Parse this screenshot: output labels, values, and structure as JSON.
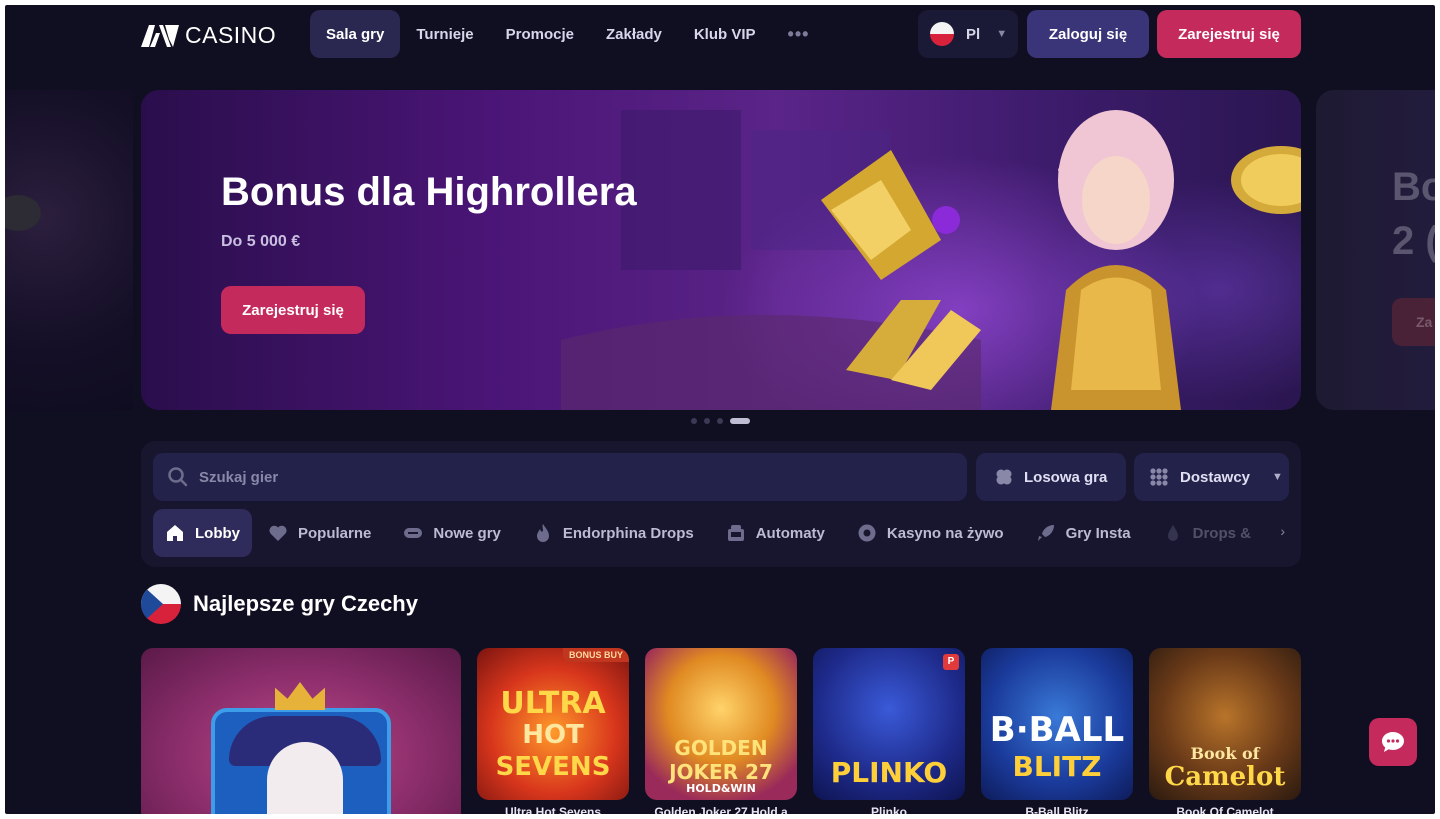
{
  "header": {
    "logo_text": "CASINO",
    "nav": [
      {
        "label": "Sala gry",
        "active": true
      },
      {
        "label": "Turnieje",
        "active": false
      },
      {
        "label": "Promocje",
        "active": false
      },
      {
        "label": "Zakłady",
        "active": false
      },
      {
        "label": "Klub VIP",
        "active": false
      }
    ],
    "more_label": "•••",
    "language": "Pl",
    "login_label": "Zaloguj się",
    "register_label": "Zarejestruj się"
  },
  "banner": {
    "title": "Bonus dla Highrollera",
    "subtitle": "Do 5 000 €",
    "button_label": "Zarejestruj się",
    "next_peek_title_1": "Bo",
    "next_peek_title_2": "2 (",
    "next_peek_button": "Za",
    "active_slide": 4,
    "slide_count": 4
  },
  "search": {
    "placeholder": "Szukaj gier",
    "random_label": "Losowa gra",
    "providers_label": "Dostawcy"
  },
  "categories": [
    {
      "label": "Lobby",
      "icon": "home-icon",
      "active": true
    },
    {
      "label": "Popularne",
      "icon": "heart-icon",
      "active": false
    },
    {
      "label": "Nowe gry",
      "icon": "new-icon",
      "active": false
    },
    {
      "label": "Endorphina Drops",
      "icon": "flame-icon",
      "active": false
    },
    {
      "label": "Automaty",
      "icon": "slot-machine-icon",
      "active": false
    },
    {
      "label": "Kasyno na żywo",
      "icon": "chip-icon",
      "active": false
    },
    {
      "label": "Gry Insta",
      "icon": "rocket-icon",
      "active": false
    },
    {
      "label": "Drops &",
      "icon": "drops-icon",
      "active": false
    }
  ],
  "section": {
    "title": "Najlepsze gry Czechy"
  },
  "games": [
    {
      "label": "Ultra Hot Sevens",
      "art_1": "ULTRA",
      "art_2": "HOT",
      "art_3": "SEVENS",
      "badge": "BONUS BUY"
    },
    {
      "label": "Golden Joker 27 Hold a",
      "art_1": "GOLDEN",
      "art_2": "JOKER 27",
      "art_3": "HOLD&WIN"
    },
    {
      "label": "Plinko",
      "art_1": "PLINKO",
      "badge": "P"
    },
    {
      "label": "B-Ball Blitz",
      "art_1": "B·BALL",
      "art_2": "BLITZ"
    },
    {
      "label": "Book Of Camelot",
      "art_1": "Book of",
      "art_2": "Camelot"
    }
  ],
  "colors": {
    "background": "#100f22",
    "accent_pink": "#c52a5c",
    "accent_purple": "#3a3478",
    "panel": "#17162e"
  }
}
